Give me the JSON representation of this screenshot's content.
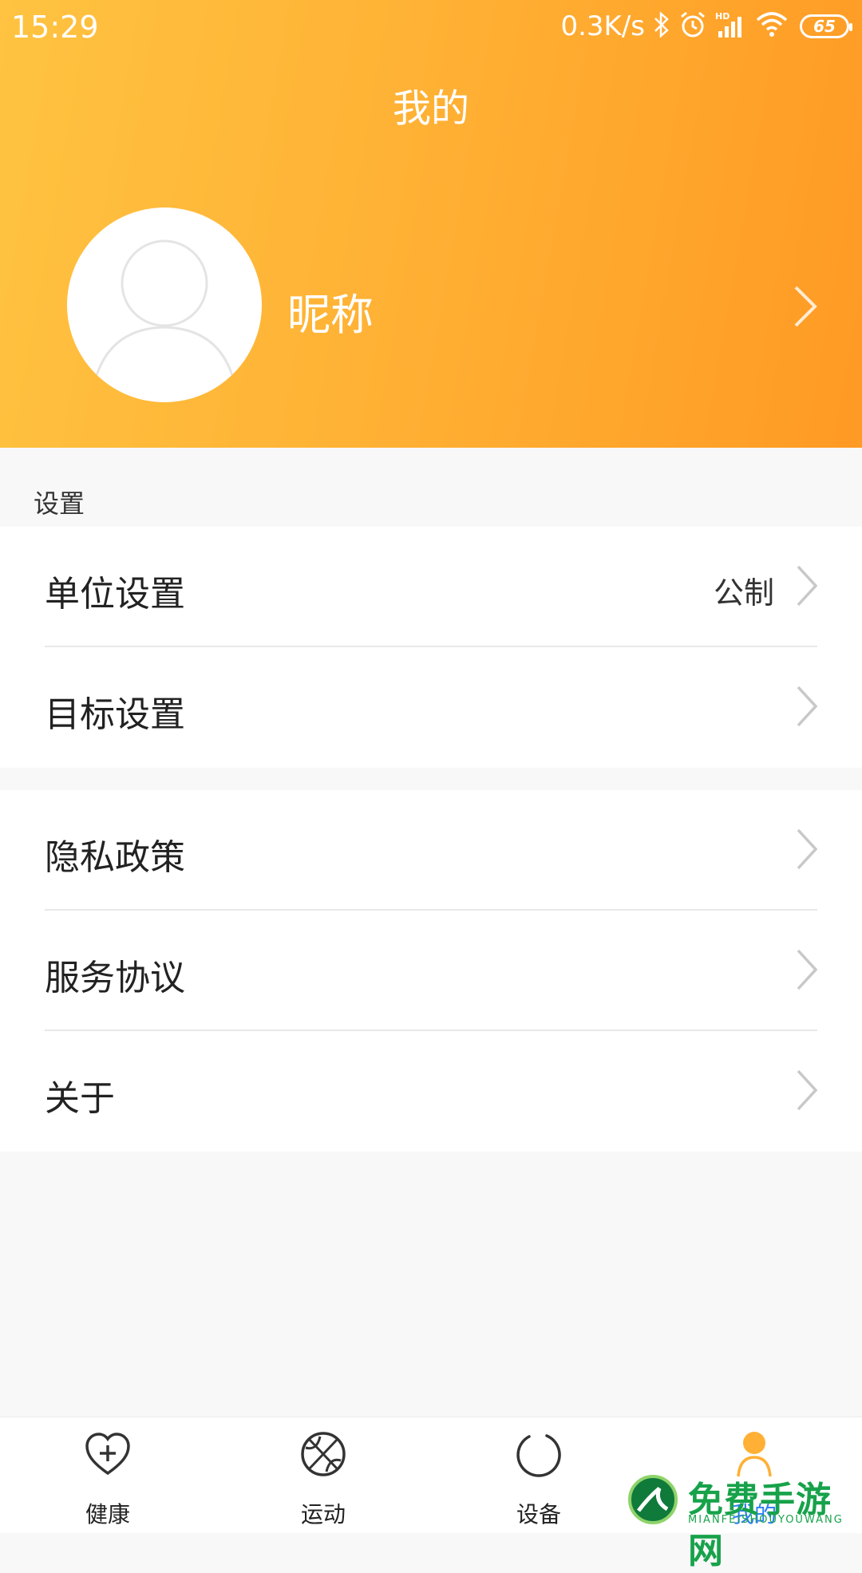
{
  "status_bar": {
    "time": "15:29",
    "net_speed": "0.3K/s",
    "battery": "65",
    "icons": [
      "bluetooth-icon",
      "alarm-icon",
      "hd-signal-icon",
      "wifi-icon",
      "battery-icon"
    ]
  },
  "header": {
    "title": "我的",
    "nickname": "昵称",
    "gradient_colors": [
      "#ffc341",
      "#ff9a24"
    ]
  },
  "settings": {
    "section_label": "设置",
    "group1": [
      {
        "label": "单位设置",
        "value": "公制"
      },
      {
        "label": "目标设置",
        "value": ""
      }
    ],
    "group2": [
      {
        "label": "隐私政策"
      },
      {
        "label": "服务协议"
      },
      {
        "label": "关于"
      }
    ]
  },
  "tabbar": {
    "active_color": "#2e7ef6",
    "tabs": [
      {
        "label": "健康",
        "icon": "heart-plus-icon"
      },
      {
        "label": "运动",
        "icon": "basketball-icon"
      },
      {
        "label": "设备",
        "icon": "device-ring-icon"
      },
      {
        "label": "我的",
        "icon": "person-icon",
        "active": true
      }
    ]
  },
  "watermark": {
    "text": "免费手游网",
    "sub": "MIANFEISHOUYOUWANG"
  }
}
